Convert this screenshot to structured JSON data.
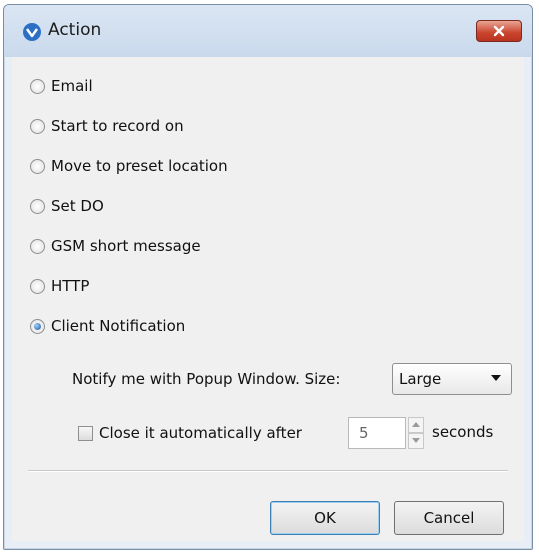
{
  "window": {
    "title": "Action",
    "close_icon": "close-icon"
  },
  "actions": [
    {
      "label": "Email",
      "selected": false
    },
    {
      "label": "Start to record on",
      "selected": false
    },
    {
      "label": "Move to preset location",
      "selected": false
    },
    {
      "label": "Set DO",
      "selected": false
    },
    {
      "label": "GSM short message",
      "selected": false
    },
    {
      "label": "HTTP",
      "selected": false
    },
    {
      "label": "Client Notification",
      "selected": true
    }
  ],
  "notify": {
    "text": "Notify me with  Popup Window.  Size:",
    "size_value": "Large"
  },
  "auto_close": {
    "label": "Close it automatically after",
    "checked": false,
    "seconds_value": "5",
    "unit_label": "seconds"
  },
  "buttons": {
    "ok": "OK",
    "cancel": "Cancel"
  },
  "colors": {
    "accent": "#1b4f9c",
    "close_button": "#c9432d",
    "window_frame": "#c9d9ec"
  }
}
